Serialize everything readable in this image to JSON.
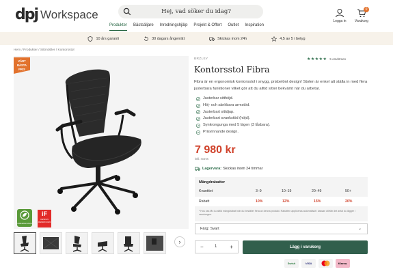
{
  "header": {
    "logo_mark": "dpj",
    "logo_text": "Workspace",
    "search_placeholder": "Hej, vad söker du idag?",
    "nav": [
      "Produkter",
      "Bästsäljare",
      "Inredningshjälp",
      "Projekt & Offert",
      "Outlet",
      "Inspiration"
    ],
    "account_label": "Logga in",
    "cart_label": "Varukorg",
    "cart_count": "0"
  },
  "usp": [
    "10 års garanti",
    "30 dagars ångerrätt",
    "Skickas inom 24h",
    "4,5 av 5 i betyg"
  ],
  "breadcrumb": "Hem / Produkter / Sittmöbler / Kontorsstol",
  "gallery": {
    "badge": "VÅRT BÄSTA PRIS",
    "award_green": "GREENGUARD",
    "award_if": "DESIGN AWARD 2022"
  },
  "product": {
    "brand": "BRZLEY",
    "rating_stars": "★★★★★",
    "rating_text": "5 omdömen",
    "title": "Kontorsstol Fibra",
    "description": "Fibra är en ergonomisk kontorsstol i snygg, prisbelönt design! Stolen är enkel att ställa in med flera justerbara funktioner vilket gör att du alltid sitter bekvämt när du arbetar.",
    "features": [
      "Justerbar sitthöjd.",
      "Höj- och sänkbara armstöd.",
      "Justerbart sittdjup.",
      "Justerbart svankstöd (höjd).",
      "Synkrongunga med 5 lägen (3 låsbara).",
      "Prisvinnande design."
    ],
    "price": "7 980 kr",
    "vat_note": "inkl. moms",
    "stock_label": "Lagervara:",
    "stock_text": "Skickas inom 24 timmar"
  },
  "quantity_discounts": {
    "title": "Mängdrabatter",
    "headers": [
      "Kvantitet",
      "3–9",
      "10–19",
      "20–49",
      "50+"
    ],
    "row_label": "Rabatt",
    "values": [
      "10%",
      "12%",
      "15%",
      "20%"
    ],
    "note": "* Hos oss får du alltid mängdrabatt när du beställer flera av denna produkt. Rabatten appliceras automatiskt i kassan utifrån det antal du lägger i varukorgen."
  },
  "purchase": {
    "color_select": "Färg: Svart",
    "quantity": "1",
    "add_to_cart": "Lägg i varukorg"
  },
  "payments": [
    "Swish",
    "VISA",
    "MC",
    "Klarna."
  ],
  "colors": {
    "accent_green": "#315f4c",
    "price_red": "#d0422b",
    "badge_orange": "#e2722d"
  }
}
